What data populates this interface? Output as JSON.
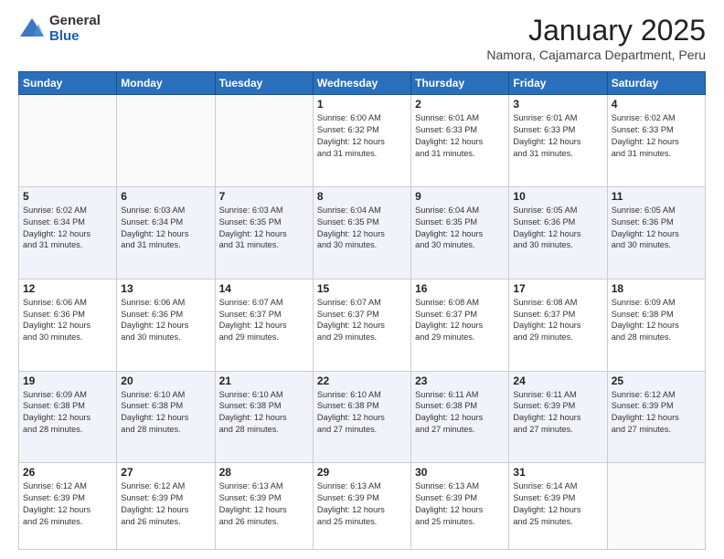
{
  "logo": {
    "general": "General",
    "blue": "Blue"
  },
  "header": {
    "month_year": "January 2025",
    "location": "Namora, Cajamarca Department, Peru"
  },
  "days_of_week": [
    "Sunday",
    "Monday",
    "Tuesday",
    "Wednesday",
    "Thursday",
    "Friday",
    "Saturday"
  ],
  "weeks": [
    [
      {
        "num": "",
        "info": ""
      },
      {
        "num": "",
        "info": ""
      },
      {
        "num": "",
        "info": ""
      },
      {
        "num": "1",
        "info": "Sunrise: 6:00 AM\nSunset: 6:32 PM\nDaylight: 12 hours\nand 31 minutes."
      },
      {
        "num": "2",
        "info": "Sunrise: 6:01 AM\nSunset: 6:33 PM\nDaylight: 12 hours\nand 31 minutes."
      },
      {
        "num": "3",
        "info": "Sunrise: 6:01 AM\nSunset: 6:33 PM\nDaylight: 12 hours\nand 31 minutes."
      },
      {
        "num": "4",
        "info": "Sunrise: 6:02 AM\nSunset: 6:33 PM\nDaylight: 12 hours\nand 31 minutes."
      }
    ],
    [
      {
        "num": "5",
        "info": "Sunrise: 6:02 AM\nSunset: 6:34 PM\nDaylight: 12 hours\nand 31 minutes."
      },
      {
        "num": "6",
        "info": "Sunrise: 6:03 AM\nSunset: 6:34 PM\nDaylight: 12 hours\nand 31 minutes."
      },
      {
        "num": "7",
        "info": "Sunrise: 6:03 AM\nSunset: 6:35 PM\nDaylight: 12 hours\nand 31 minutes."
      },
      {
        "num": "8",
        "info": "Sunrise: 6:04 AM\nSunset: 6:35 PM\nDaylight: 12 hours\nand 30 minutes."
      },
      {
        "num": "9",
        "info": "Sunrise: 6:04 AM\nSunset: 6:35 PM\nDaylight: 12 hours\nand 30 minutes."
      },
      {
        "num": "10",
        "info": "Sunrise: 6:05 AM\nSunset: 6:36 PM\nDaylight: 12 hours\nand 30 minutes."
      },
      {
        "num": "11",
        "info": "Sunrise: 6:05 AM\nSunset: 6:36 PM\nDaylight: 12 hours\nand 30 minutes."
      }
    ],
    [
      {
        "num": "12",
        "info": "Sunrise: 6:06 AM\nSunset: 6:36 PM\nDaylight: 12 hours\nand 30 minutes."
      },
      {
        "num": "13",
        "info": "Sunrise: 6:06 AM\nSunset: 6:36 PM\nDaylight: 12 hours\nand 30 minutes."
      },
      {
        "num": "14",
        "info": "Sunrise: 6:07 AM\nSunset: 6:37 PM\nDaylight: 12 hours\nand 29 minutes."
      },
      {
        "num": "15",
        "info": "Sunrise: 6:07 AM\nSunset: 6:37 PM\nDaylight: 12 hours\nand 29 minutes."
      },
      {
        "num": "16",
        "info": "Sunrise: 6:08 AM\nSunset: 6:37 PM\nDaylight: 12 hours\nand 29 minutes."
      },
      {
        "num": "17",
        "info": "Sunrise: 6:08 AM\nSunset: 6:37 PM\nDaylight: 12 hours\nand 29 minutes."
      },
      {
        "num": "18",
        "info": "Sunrise: 6:09 AM\nSunset: 6:38 PM\nDaylight: 12 hours\nand 28 minutes."
      }
    ],
    [
      {
        "num": "19",
        "info": "Sunrise: 6:09 AM\nSunset: 6:38 PM\nDaylight: 12 hours\nand 28 minutes."
      },
      {
        "num": "20",
        "info": "Sunrise: 6:10 AM\nSunset: 6:38 PM\nDaylight: 12 hours\nand 28 minutes."
      },
      {
        "num": "21",
        "info": "Sunrise: 6:10 AM\nSunset: 6:38 PM\nDaylight: 12 hours\nand 28 minutes."
      },
      {
        "num": "22",
        "info": "Sunrise: 6:10 AM\nSunset: 6:38 PM\nDaylight: 12 hours\nand 27 minutes."
      },
      {
        "num": "23",
        "info": "Sunrise: 6:11 AM\nSunset: 6:38 PM\nDaylight: 12 hours\nand 27 minutes."
      },
      {
        "num": "24",
        "info": "Sunrise: 6:11 AM\nSunset: 6:39 PM\nDaylight: 12 hours\nand 27 minutes."
      },
      {
        "num": "25",
        "info": "Sunrise: 6:12 AM\nSunset: 6:39 PM\nDaylight: 12 hours\nand 27 minutes."
      }
    ],
    [
      {
        "num": "26",
        "info": "Sunrise: 6:12 AM\nSunset: 6:39 PM\nDaylight: 12 hours\nand 26 minutes."
      },
      {
        "num": "27",
        "info": "Sunrise: 6:12 AM\nSunset: 6:39 PM\nDaylight: 12 hours\nand 26 minutes."
      },
      {
        "num": "28",
        "info": "Sunrise: 6:13 AM\nSunset: 6:39 PM\nDaylight: 12 hours\nand 26 minutes."
      },
      {
        "num": "29",
        "info": "Sunrise: 6:13 AM\nSunset: 6:39 PM\nDaylight: 12 hours\nand 25 minutes."
      },
      {
        "num": "30",
        "info": "Sunrise: 6:13 AM\nSunset: 6:39 PM\nDaylight: 12 hours\nand 25 minutes."
      },
      {
        "num": "31",
        "info": "Sunrise: 6:14 AM\nSunset: 6:39 PM\nDaylight: 12 hours\nand 25 minutes."
      },
      {
        "num": "",
        "info": ""
      }
    ]
  ]
}
